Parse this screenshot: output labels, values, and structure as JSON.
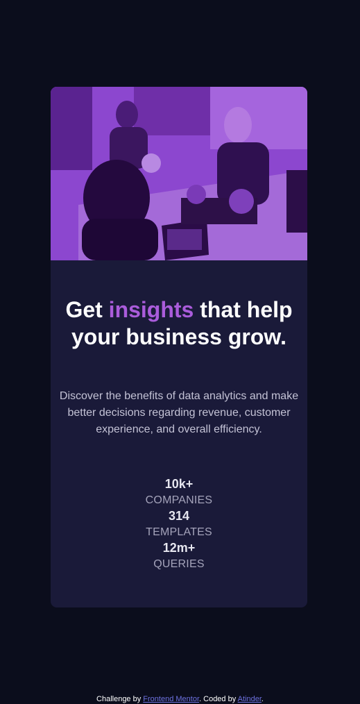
{
  "card": {
    "image_alt": "Three women working at a desk with laptops",
    "headline": {
      "before": "Get ",
      "accent": "insights",
      "after": " that help your business grow."
    },
    "description": "Discover the benefits of data analytics and make better decisions regarding revenue, customer experience, and overall efficiency.",
    "stats": [
      {
        "value": "10k+",
        "label": "companies"
      },
      {
        "value": "314",
        "label": "templates"
      },
      {
        "value": "12m+",
        "label": "queries"
      }
    ]
  },
  "footer": {
    "prefix": "Challenge by ",
    "link1": "Frontend Mentor",
    "middle": ". Coded by ",
    "link2": "Atinder",
    "suffix": "."
  },
  "colors": {
    "background": "#0b0d1c",
    "card": "#1a1a39",
    "accent": "#aa5cdb",
    "image_tint": "#8f4bd2"
  }
}
